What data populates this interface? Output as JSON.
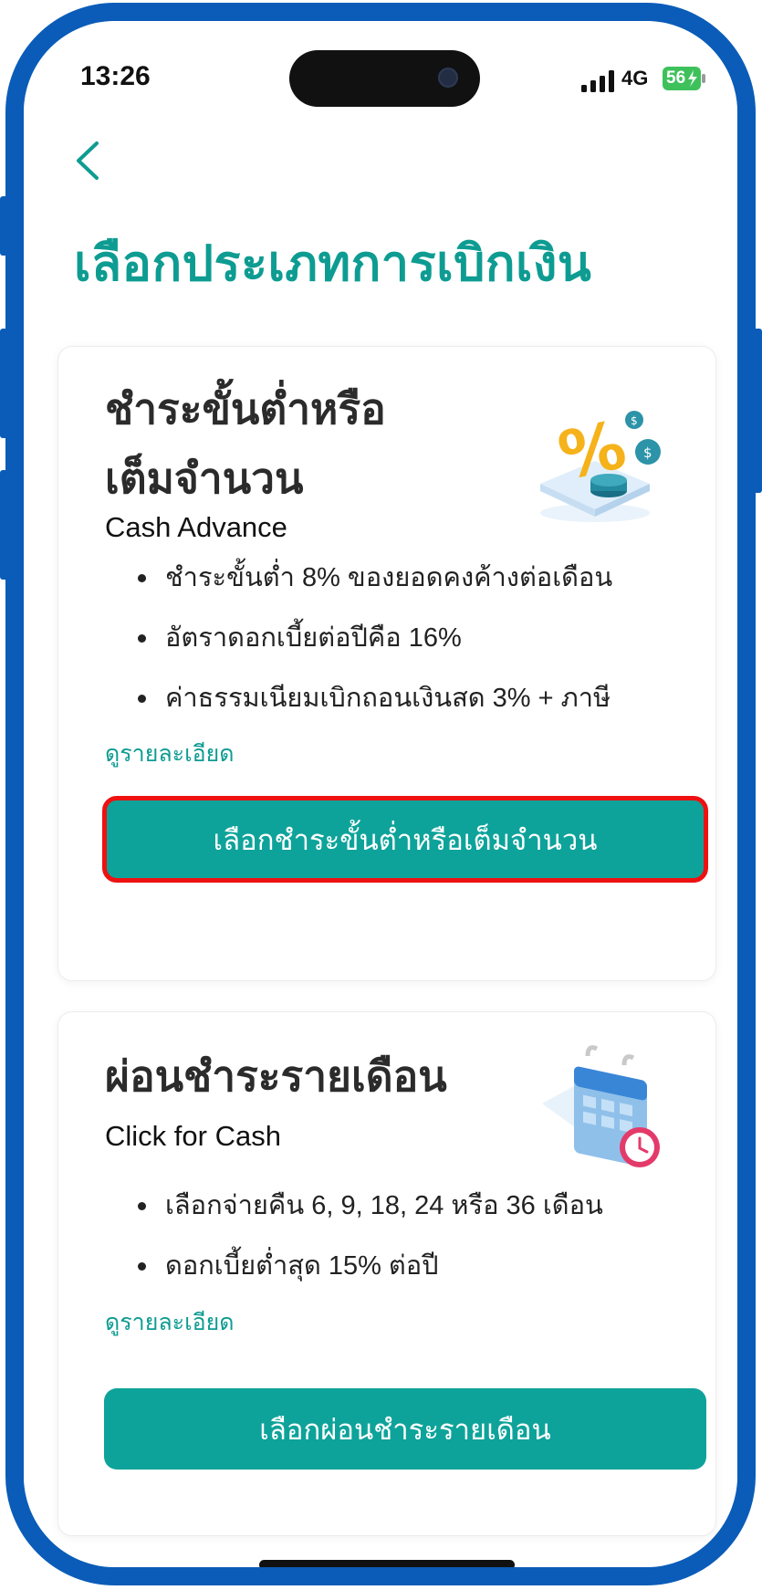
{
  "status_bar": {
    "time": "13:26",
    "network": "4G",
    "battery": "56"
  },
  "header": {
    "title": "เลือกประเภทการเบิกเงิน"
  },
  "cards": [
    {
      "title_line1": "ชำระขั้นต่ำหรือ",
      "title_line2": "เต็มจำนวน",
      "subtitle": "Cash Advance",
      "bullets": [
        "ชำระขั้นต่ำ 8% ของยอดคงค้างต่อเดือน",
        "อัตราดอกเบี้ยต่อปีคือ 16%",
        "ค่าธรรมเนียมเบิกถอนเงินสด 3% + ภาษี"
      ],
      "detail_link": "ดูรายละเอียด",
      "button_label": "เลือกชำระขั้นต่ำหรือเต็มจำนวน",
      "illustration": "percent-coins-icon"
    },
    {
      "title_line1": "ผ่อนชำระรายเดือน",
      "subtitle": "Click for Cash",
      "bullets": [
        "เลือกจ่ายคืน 6, 9, 18, 24 หรือ 36 เดือน",
        "ดอกเบี้ยต่ำสุด 15% ต่อปี"
      ],
      "detail_link": "ดูรายละเอียด",
      "button_label": "เลือกผ่อนชำระรายเดือน",
      "illustration": "calendar-clock-icon"
    }
  ],
  "colors": {
    "accent": "#0ea39a",
    "title": "#0e9c92",
    "frame": "#0a5cb8",
    "highlight": "#ee1111"
  }
}
